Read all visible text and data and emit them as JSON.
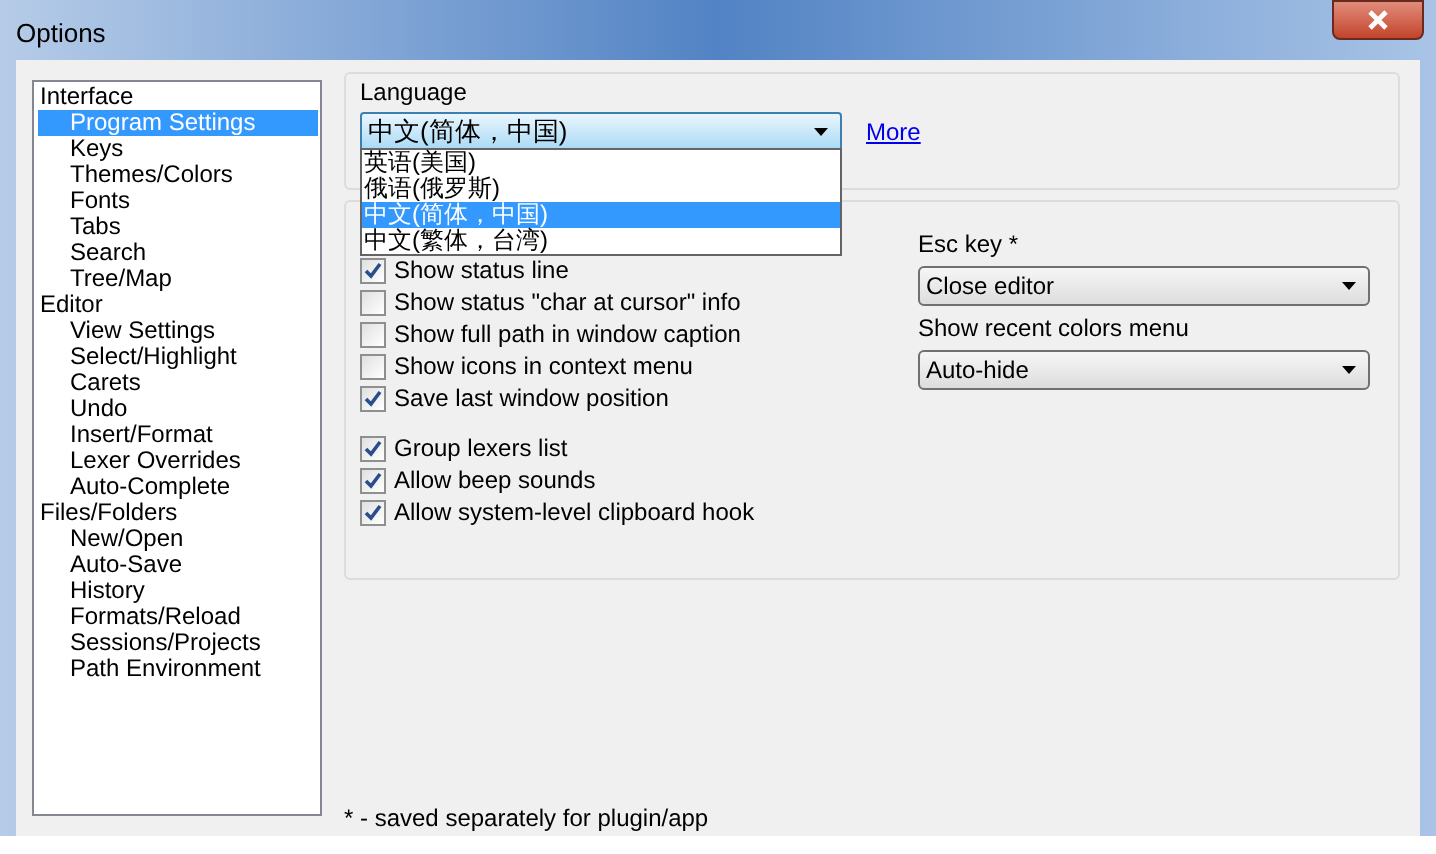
{
  "window": {
    "title": "Options"
  },
  "tree": [
    {
      "label": "Interface",
      "selected": false,
      "children": [
        {
          "label": "Program Settings",
          "selected": true
        },
        {
          "label": "Keys",
          "selected": false
        },
        {
          "label": "Themes/Colors",
          "selected": false
        },
        {
          "label": "Fonts",
          "selected": false
        },
        {
          "label": "Tabs",
          "selected": false
        },
        {
          "label": "Search",
          "selected": false
        },
        {
          "label": "Tree/Map",
          "selected": false
        }
      ]
    },
    {
      "label": "Editor",
      "selected": false,
      "children": [
        {
          "label": "View Settings",
          "selected": false
        },
        {
          "label": "Select/Highlight",
          "selected": false
        },
        {
          "label": "Carets",
          "selected": false
        },
        {
          "label": "Undo",
          "selected": false
        },
        {
          "label": "Insert/Format",
          "selected": false
        },
        {
          "label": "Lexer Overrides",
          "selected": false
        },
        {
          "label": "Auto-Complete",
          "selected": false
        }
      ]
    },
    {
      "label": "Files/Folders",
      "selected": false,
      "children": [
        {
          "label": "New/Open",
          "selected": false
        },
        {
          "label": "Auto-Save",
          "selected": false
        },
        {
          "label": "History",
          "selected": false
        },
        {
          "label": "Formats/Reload",
          "selected": false
        },
        {
          "label": "Sessions/Projects",
          "selected": false
        },
        {
          "label": "Path Environment",
          "selected": false
        }
      ]
    }
  ],
  "language": {
    "label": "Language",
    "value": "中文(简体，中国)",
    "expanded": true,
    "link": "More",
    "options": [
      {
        "label": "英语(美国)",
        "selected": false
      },
      {
        "label": "俄语(俄罗斯)",
        "selected": false
      },
      {
        "label": "中文(简体，中国)",
        "selected": true
      },
      {
        "label": "中文(繁体，台湾)",
        "selected": false
      }
    ]
  },
  "checkbox_groups": [
    {
      "items": [
        {
          "label": "Show status line",
          "checked": true
        },
        {
          "label": "Show status \"char at cursor\" info",
          "checked": false
        },
        {
          "label": "Show full path in window caption",
          "checked": false
        },
        {
          "label": "Show icons in context menu",
          "checked": false
        },
        {
          "label": "Save last window position",
          "checked": true
        }
      ]
    },
    {
      "items": [
        {
          "label": "Group lexers list",
          "checked": true
        },
        {
          "label": "Allow beep sounds",
          "checked": true
        },
        {
          "label": "Allow system-level clipboard hook",
          "checked": true
        }
      ]
    }
  ],
  "selects": [
    {
      "label": "Esc key *",
      "value": "Close editor"
    },
    {
      "label": "Show recent colors menu",
      "value": "Auto-hide"
    }
  ],
  "footnote": "* - saved separately for plugin/app"
}
